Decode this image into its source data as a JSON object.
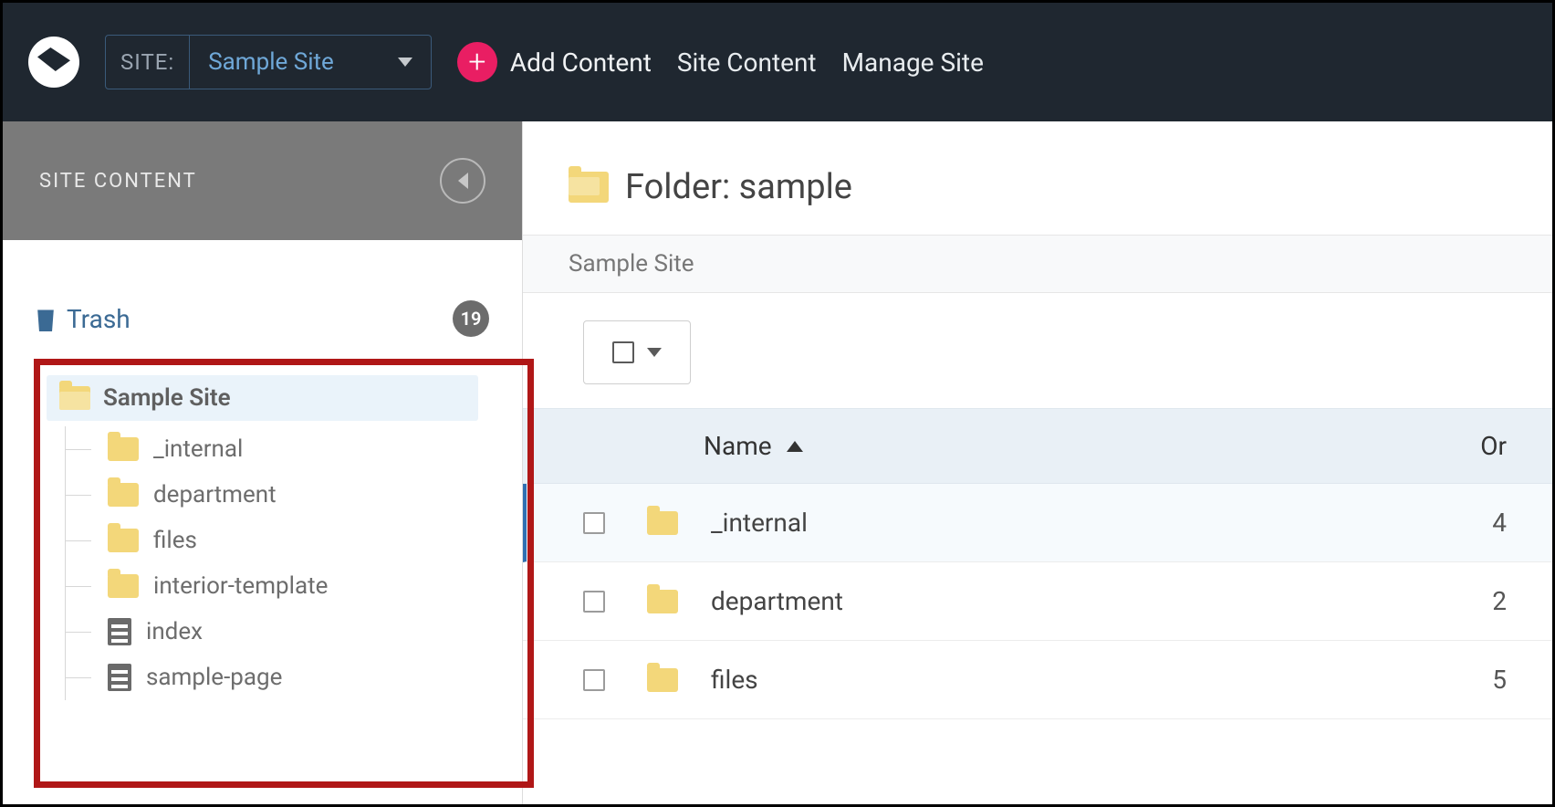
{
  "topbar": {
    "site_label": "SITE:",
    "site_value": "Sample Site",
    "add_content": "Add Content",
    "site_content": "Site Content",
    "manage_site": "Manage Site"
  },
  "sidebar": {
    "header": "SITE CONTENT",
    "trash_label": "Trash",
    "trash_count": "19",
    "root_label": "Sample Site",
    "children": [
      {
        "label": "_internal",
        "type": "folder"
      },
      {
        "label": "department",
        "type": "folder"
      },
      {
        "label": "files",
        "type": "folder"
      },
      {
        "label": "interior-template",
        "type": "folder"
      },
      {
        "label": "index",
        "type": "page"
      },
      {
        "label": "sample-page",
        "type": "page"
      }
    ]
  },
  "main": {
    "title_prefix": "Folder:",
    "title_name": "sample",
    "breadcrumb": "Sample Site",
    "columns": {
      "name": "Name",
      "order": "Or"
    },
    "rows": [
      {
        "name": "_internal",
        "order": "4",
        "selected": true
      },
      {
        "name": "department",
        "order": "2",
        "selected": false
      },
      {
        "name": "files",
        "order": "5",
        "selected": false
      }
    ]
  }
}
